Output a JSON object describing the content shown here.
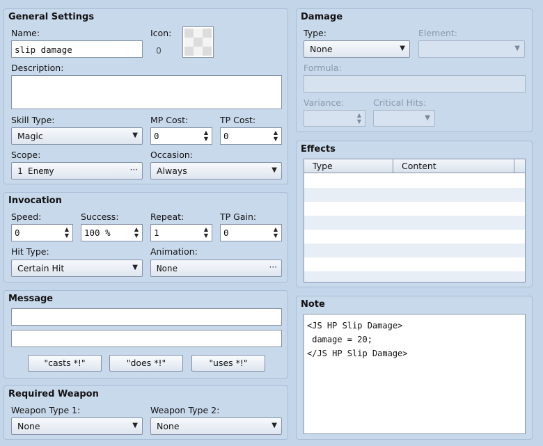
{
  "general": {
    "title": "General Settings",
    "name_label": "Name:",
    "name_value": "slip damage",
    "icon_label": "Icon:",
    "icon_index": "0",
    "description_label": "Description:",
    "description_value": "",
    "skill_type_label": "Skill Type:",
    "skill_type_value": "Magic",
    "mp_cost_label": "MP Cost:",
    "mp_cost_value": "0",
    "tp_cost_label": "TP Cost:",
    "tp_cost_value": "0",
    "scope_label": "Scope:",
    "scope_value": "1 Enemy",
    "occasion_label": "Occasion:",
    "occasion_value": "Always"
  },
  "invocation": {
    "title": "Invocation",
    "speed_label": "Speed:",
    "speed_value": "0",
    "success_label": "Success:",
    "success_value": "100 %",
    "repeat_label": "Repeat:",
    "repeat_value": "1",
    "tp_gain_label": "TP Gain:",
    "tp_gain_value": "0",
    "hit_type_label": "Hit Type:",
    "hit_type_value": "Certain Hit",
    "animation_label": "Animation:",
    "animation_value": "None"
  },
  "message": {
    "title": "Message",
    "line1": "",
    "line2": "",
    "buttons": [
      "\"casts *!\"",
      "\"does *!\"",
      "\"uses *!\""
    ]
  },
  "required_weapon": {
    "title": "Required Weapon",
    "type1_label": "Weapon Type 1:",
    "type1_value": "None",
    "type2_label": "Weapon Type 2:",
    "type2_value": "None"
  },
  "damage": {
    "title": "Damage",
    "type_label": "Type:",
    "type_value": "None",
    "element_label": "Element:",
    "element_value": "",
    "formula_label": "Formula:",
    "formula_value": "",
    "variance_label": "Variance:",
    "variance_value": "",
    "critical_label": "Critical Hits:",
    "critical_value": ""
  },
  "effects": {
    "title": "Effects",
    "columns": [
      "Type",
      "Content"
    ]
  },
  "note": {
    "title": "Note",
    "text": "<JS HP Slip Damage>\n damage = 20;\n</JS HP Slip Damage>"
  }
}
